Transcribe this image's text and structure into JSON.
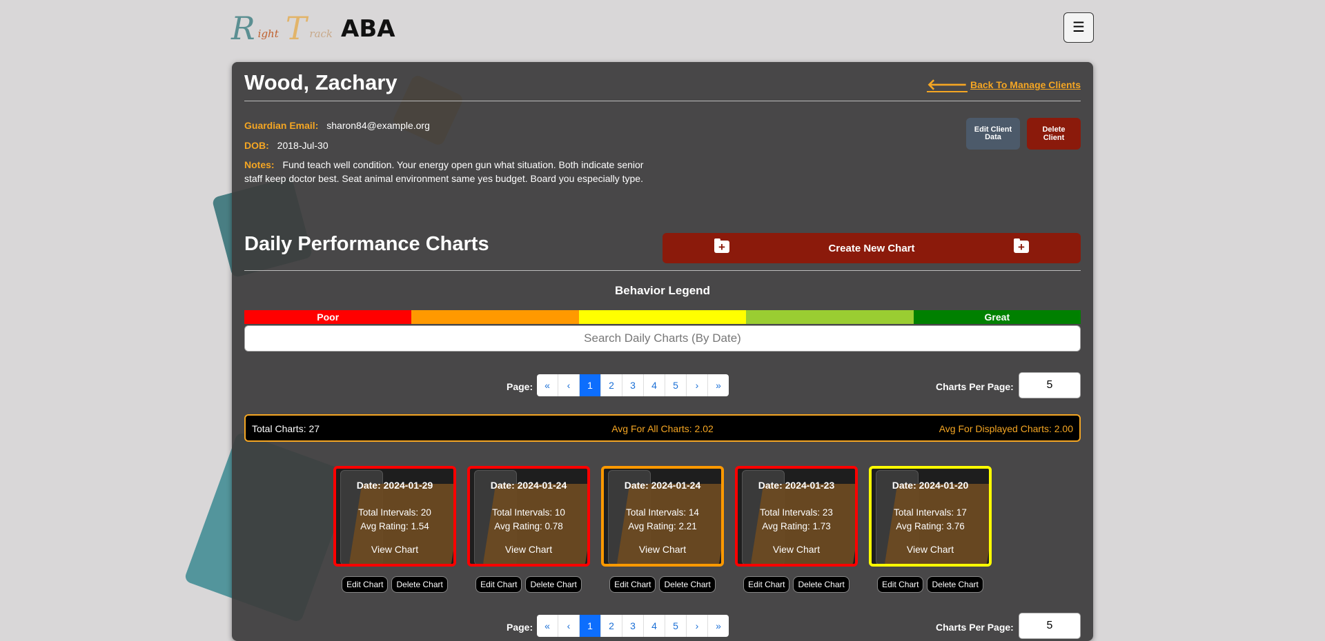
{
  "header": {
    "logo": {
      "word1_cap": "R",
      "word1_rest": "ight",
      "word2_cap": "T",
      "word2_rest": "rack",
      "word3": "ABA"
    },
    "menu_icon": "☰"
  },
  "client": {
    "name": "Wood, Zachary",
    "back_link": "Back To Manage Clients",
    "guardian_email_label": "Guardian Email:",
    "guardian_email": "sharon84@example.org",
    "dob_label": "DOB:",
    "dob": "2018-Jul-30",
    "notes_label": "Notes:",
    "notes": "Fund teach well condition. Your energy open gun what situation. Both indicate senior staff keep doctor best. Seat animal environment same yes budget. Board you especially type.",
    "edit_button": "Edit Client Data",
    "delete_button": "Delete Client"
  },
  "charts_section": {
    "title": "Daily Performance Charts",
    "create_button": "Create New Chart",
    "legend_title": "Behavior Legend",
    "legend": [
      {
        "label": "Poor",
        "color": "#ff0000"
      },
      {
        "label": "",
        "color": "#ff9900"
      },
      {
        "label": "",
        "color": "#ffff00"
      },
      {
        "label": "",
        "color": "#9acd32"
      },
      {
        "label": "Great",
        "color": "#008000"
      }
    ],
    "search_placeholder": "Search Daily Charts (By Date)",
    "pager_label": "Page:",
    "pager": [
      "«",
      "‹",
      "1",
      "2",
      "3",
      "4",
      "5",
      "›",
      "»"
    ],
    "active_page": "1",
    "per_page_label": "Charts Per Page:",
    "per_page_value": "5",
    "stats": {
      "total": "Total Charts: 27",
      "avg_all": "Avg For All Charts: 2.02",
      "avg_displayed": "Avg For Displayed Charts: 2.00"
    },
    "cards": [
      {
        "date": "Date: 2024-01-29",
        "intervals": "Total Intervals: 20",
        "avg": "Avg Rating: 1.54",
        "view": "View Chart",
        "border": "#ff0000"
      },
      {
        "date": "Date: 2024-01-24",
        "intervals": "Total Intervals: 10",
        "avg": "Avg Rating: 0.78",
        "view": "View Chart",
        "border": "#ff0000"
      },
      {
        "date": "Date: 2024-01-24",
        "intervals": "Total Intervals: 14",
        "avg": "Avg Rating: 2.21",
        "view": "View Chart",
        "border": "#ff9900"
      },
      {
        "date": "Date: 2024-01-23",
        "intervals": "Total Intervals: 23",
        "avg": "Avg Rating: 1.73",
        "view": "View Chart",
        "border": "#ff0000"
      },
      {
        "date": "Date: 2024-01-20",
        "intervals": "Total Intervals: 17",
        "avg": "Avg Rating: 3.76",
        "view": "View Chart",
        "border": "#ffff00"
      }
    ],
    "edit_chart_label": "Edit Chart",
    "delete_chart_label": "Delete Chart"
  },
  "colors": {
    "accent": "#f5a623",
    "danger": "#8b1a0b",
    "panel": "#3c3c3c"
  }
}
